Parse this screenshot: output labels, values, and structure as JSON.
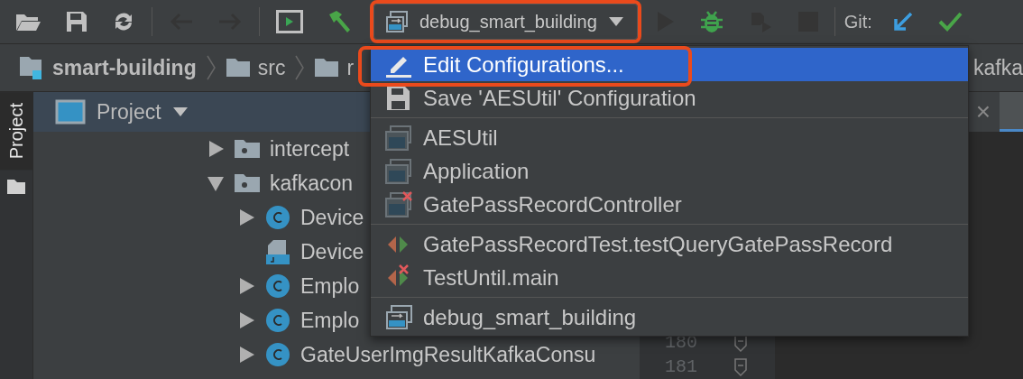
{
  "toolbar": {
    "left_buttons": [
      {
        "kind": "open",
        "disabled": false
      },
      {
        "kind": "save",
        "disabled": false
      },
      {
        "kind": "sync",
        "disabled": false
      },
      {
        "kind": "back",
        "disabled": true
      },
      {
        "kind": "forward",
        "disabled": true
      },
      {
        "kind": "terminal",
        "disabled": false
      },
      {
        "kind": "build",
        "disabled": false
      }
    ],
    "config": {
      "label": "debug_smart_building",
      "outlined": true
    },
    "right_buttons": [
      {
        "kind": "run",
        "disabled": true
      },
      {
        "kind": "debug",
        "disabled": false
      },
      {
        "kind": "coverage",
        "disabled": true
      },
      {
        "kind": "stop",
        "disabled": true
      }
    ],
    "git_label": "Git:",
    "git_buttons": [
      {
        "kind": "update"
      },
      {
        "kind": "commit"
      }
    ]
  },
  "breadcrumb": [
    {
      "kind": "module",
      "label": "smart-building"
    },
    {
      "kind": "folder",
      "label": "src"
    },
    {
      "kind": "folder",
      "label": "r"
    }
  ],
  "breadcrumb_end": {
    "label": "kafka"
  },
  "side_tab": {
    "label": "Project"
  },
  "project_panel": {
    "title": "Project"
  },
  "tree": [
    {
      "kind": "package",
      "label": "intercept",
      "expanded": false
    },
    {
      "kind": "package",
      "label": "kafkacon",
      "expanded": true,
      "children": [
        {
          "kind": "class",
          "label": "Device",
          "expanded": false
        },
        {
          "kind": "file",
          "label": "Device"
        },
        {
          "kind": "class",
          "label": "Emplo",
          "expanded": false
        },
        {
          "kind": "class",
          "label": "Emplo",
          "expanded": false
        },
        {
          "kind": "class",
          "label": "GateUserImgResultKafkaConsu",
          "expanded": false
        }
      ]
    }
  ],
  "editor": {
    "tab_close": "×",
    "line_numbers": [
      "180",
      "181"
    ]
  },
  "menu": {
    "groups": [
      [
        {
          "kind": "edit",
          "label": "Edit Configurations...",
          "selected": true,
          "outlined": true
        },
        {
          "kind": "save",
          "label": "Save 'AESUtil' Configuration",
          "selected": false,
          "outlined": false
        }
      ],
      [
        {
          "kind": "app",
          "label": "AESUtil",
          "selected": false,
          "outlined": false
        },
        {
          "kind": "app",
          "label": "Application",
          "selected": false,
          "outlined": false
        },
        {
          "kind": "app-error",
          "label": "GatePassRecordController",
          "selected": false,
          "outlined": false
        }
      ],
      [
        {
          "kind": "test",
          "label": "GatePassRecordTest.testQueryGatePassRecord",
          "selected": false,
          "outlined": false
        },
        {
          "kind": "test-error",
          "label": "TestUntil.main",
          "selected": false,
          "outlined": false
        }
      ],
      [
        {
          "kind": "compound",
          "label": "debug_smart_building",
          "selected": false,
          "outlined": false
        }
      ]
    ]
  }
}
